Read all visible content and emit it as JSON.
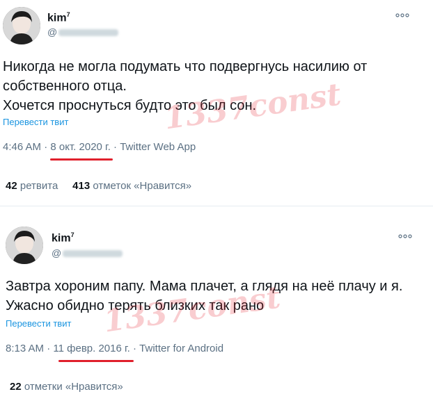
{
  "tweets": [
    {
      "author": {
        "name": "kim",
        "sup": "7",
        "handle_prefix": "@"
      },
      "more_icon": "more-horizontal-icon",
      "text": "Никогда не могла подумать что подвергнусь насилию от собственного отца.\nХочется проснуться будто это был сон.",
      "translate": "Перевести твит",
      "time": "4:46 AM",
      "sep": "·",
      "date": "8 окт. 2020 г.",
      "source": "Twitter Web App",
      "retweets_count": "42",
      "retweets_label": "ретвита",
      "likes_count": "413",
      "likes_label": "отметок «Нравится»",
      "watermark": "1337const"
    },
    {
      "author": {
        "name": "kim",
        "sup": "7",
        "handle_prefix": "@"
      },
      "more_icon": "more-horizontal-icon",
      "text": "Завтра хороним папу. Мама плачет, а глядя на неё плачу и я. Ужасно обидно терять близких так рано",
      "translate": "Перевести твит",
      "time": "8:13 AM",
      "sep": "·",
      "date": "11 февр. 2016 г.",
      "source": "Twitter for Android",
      "likes_count": "22",
      "likes_label": "отметки «Нравится»",
      "watermark": "1337const"
    }
  ],
  "colors": {
    "accent": "#1b95e0",
    "underline": "#e0202c",
    "muted": "#5b7083"
  }
}
